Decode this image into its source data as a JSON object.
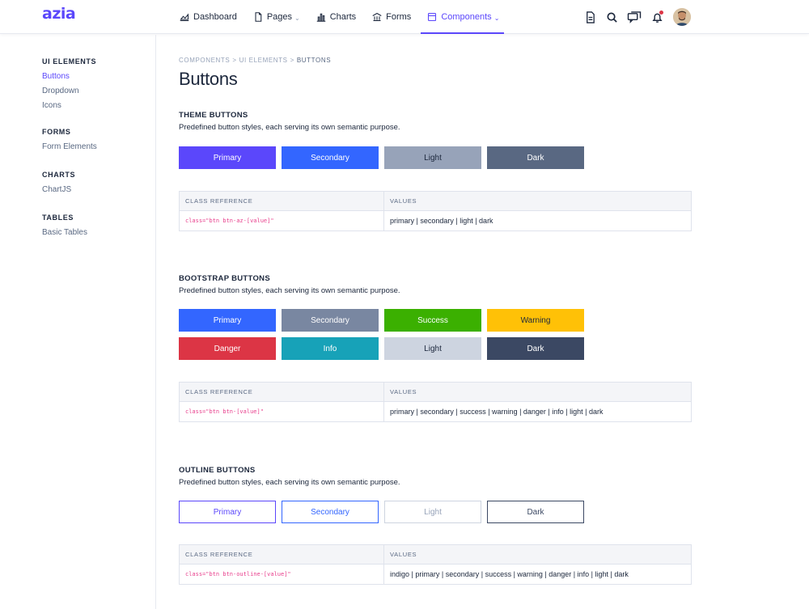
{
  "app": {
    "logo": "azia"
  },
  "header": {
    "nav": [
      {
        "label": "Dashboard",
        "icon": "chart-area-icon"
      },
      {
        "label": "Pages",
        "icon": "document-icon",
        "has_dropdown": true
      },
      {
        "label": "Charts",
        "icon": "bar-chart-icon"
      },
      {
        "label": "Forms",
        "icon": "bank-icon"
      },
      {
        "label": "Components",
        "icon": "box-icon",
        "has_dropdown": true,
        "active": true
      }
    ],
    "caret": "⌄",
    "right_icons": [
      "document-icon",
      "search-icon",
      "chat-icon",
      "bell-icon"
    ],
    "user": {
      "avatar": "avatar"
    }
  },
  "sidebar": {
    "sections": [
      {
        "title": "UI ELEMENTS",
        "items": [
          "Buttons",
          "Dropdown",
          "Icons"
        ]
      },
      {
        "title": "FORMS",
        "items": [
          "Form Elements"
        ]
      },
      {
        "title": "CHARTS",
        "items": [
          "ChartJS"
        ]
      },
      {
        "title": "TABLES",
        "items": [
          "Basic Tables"
        ]
      }
    ],
    "active_item": "Buttons"
  },
  "main": {
    "breadcrumb": [
      "COMPONENTS",
      "UI ELEMENTS",
      "BUTTONS"
    ],
    "breadcrumb_sep": ">",
    "title": "Buttons",
    "table_headers": {
      "class_ref": "CLASS REFERENCE",
      "values": "VALUES"
    },
    "sections": [
      {
        "title": "THEME BUTTONS",
        "desc": "Predefined button styles, each serving its own semantic purpose.",
        "rows": [
          [
            {
              "label": "Primary",
              "bg": "#5b47fb",
              "fg": "#ffffff"
            },
            {
              "label": "Secondary",
              "bg": "#3366ff",
              "fg": "#ffffff"
            },
            {
              "label": "Light",
              "bg": "#97a3b9",
              "fg": "#1c273c"
            },
            {
              "label": "Dark",
              "bg": "#596882",
              "fg": "#ffffff"
            }
          ]
        ],
        "class_ref": "class=\"btn btn-az-[value]\"",
        "values": "primary | secondary | light | dark"
      },
      {
        "title": "BOOTSTRAP BUTTONS",
        "desc": "Predefined button styles, each serving its own semantic purpose.",
        "rows": [
          [
            {
              "label": "Primary",
              "bg": "#3366ff",
              "fg": "#ffffff"
            },
            {
              "label": "Secondary",
              "bg": "#7987a1",
              "fg": "#ffffff"
            },
            {
              "label": "Success",
              "bg": "#3bb001",
              "fg": "#ffffff"
            },
            {
              "label": "Warning",
              "bg": "#ffc107",
              "fg": "#1c273c"
            }
          ],
          [
            {
              "label": "Danger",
              "bg": "#dc3545",
              "fg": "#ffffff"
            },
            {
              "label": "Info",
              "bg": "#17a2b8",
              "fg": "#ffffff"
            },
            {
              "label": "Light",
              "bg": "#cdd4e0",
              "fg": "#1c273c"
            },
            {
              "label": "Dark",
              "bg": "#3b4863",
              "fg": "#ffffff"
            }
          ]
        ],
        "class_ref": "class=\"btn btn-[value]\"",
        "values": "primary | secondary | success | warning | danger | info | light | dark"
      },
      {
        "title": "OUTLINE BUTTONS",
        "desc": "Predefined button styles, each serving its own semantic purpose.",
        "rows": [
          [
            {
              "label": "Primary",
              "outline": "#5b47fb"
            },
            {
              "label": "Secondary",
              "outline": "#3366ff"
            },
            {
              "label": "Light",
              "outline": "#cdd4e0",
              "fg": "#97a3b9"
            },
            {
              "label": "Dark",
              "outline": "#3b4863"
            }
          ]
        ],
        "class_ref": "class=\"btn btn-outline-[value]\"",
        "values": "indigo | primary | secondary | success | warning | danger | info | light | dark"
      }
    ]
  }
}
